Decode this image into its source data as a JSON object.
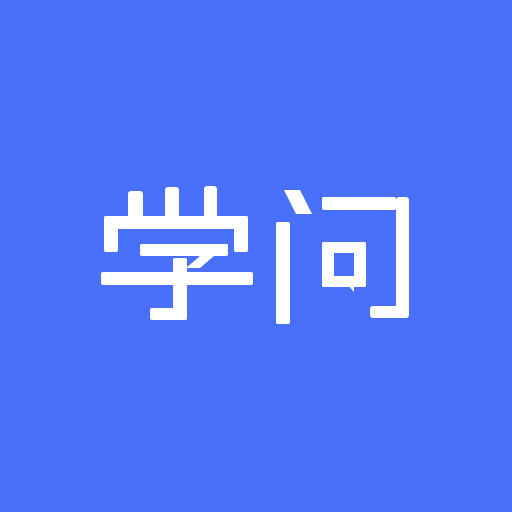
{
  "logo": {
    "text": "学问",
    "background_color": "#4a6ffa",
    "glyph_color": "#ffffff"
  }
}
